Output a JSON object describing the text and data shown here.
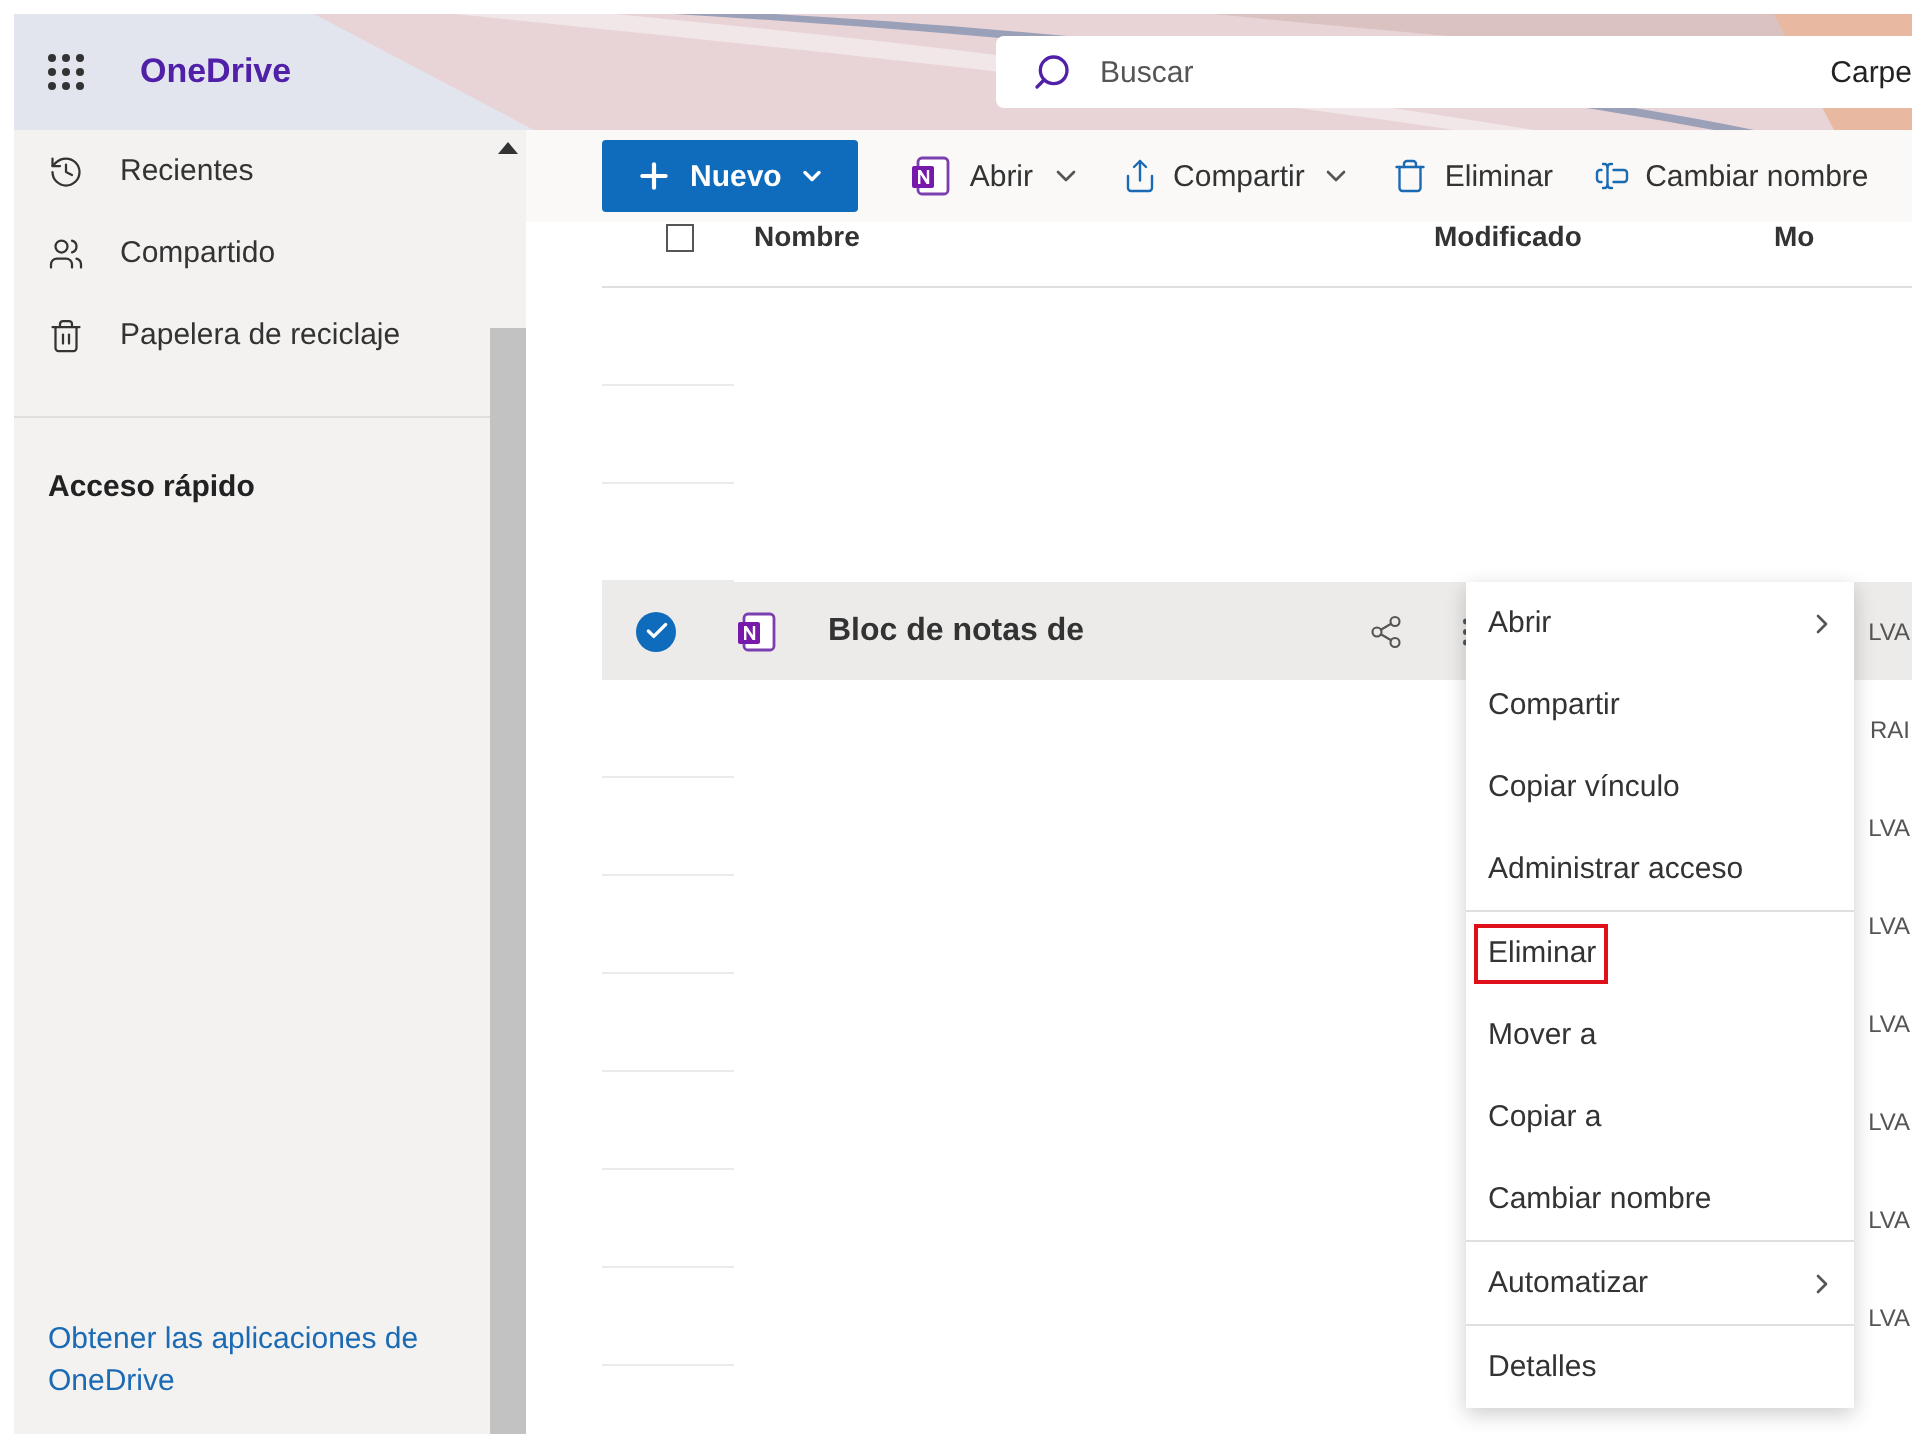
{
  "header": {
    "app_name": "OneDrive",
    "search": {
      "placeholder": "Buscar"
    },
    "search_scope": "Carpe"
  },
  "sidebar": {
    "items": [
      {
        "label": "Recientes"
      },
      {
        "label": "Compartido"
      },
      {
        "label": "Papelera de reciclaje"
      }
    ],
    "section_title": "Acceso rápido",
    "footer_link": "Obtener las aplicaciones de OneDrive"
  },
  "toolbar": {
    "items": [
      {
        "kind": "primary",
        "label": "Nuevo"
      },
      {
        "kind": "dropdown",
        "label": "Abrir"
      },
      {
        "kind": "dropdown",
        "label": "Compartir"
      },
      {
        "kind": "plain",
        "label": "Eliminar"
      },
      {
        "kind": "plain",
        "label": "Cambiar nombre"
      }
    ]
  },
  "file_list": {
    "select_all": {
      "checked": false
    },
    "columns": [
      "Nombre",
      "Modificado",
      "Mo"
    ],
    "rows": [
      {
        "selected": false
      },
      {
        "selected": false
      },
      {
        "selected": false
      },
      {
        "selected": true,
        "name": "Bloc de notas de",
        "column_4": "LVA"
      },
      {
        "selected": false,
        "column_4": "RAI"
      },
      {
        "selected": false,
        "column_4": "LVA"
      },
      {
        "selected": false,
        "column_4": "LVA"
      },
      {
        "selected": false,
        "column_4": "LVA"
      },
      {
        "selected": false,
        "column_4": "LVA"
      },
      {
        "selected": false,
        "column_4": "LVA"
      },
      {
        "selected": false,
        "column_4": "LVA"
      }
    ]
  },
  "context_menu": {
    "items": [
      {
        "label": "Abrir",
        "submenu": true,
        "highlighted": false,
        "divider_after": false
      },
      {
        "label": "Compartir",
        "submenu": false,
        "highlighted": false,
        "divider_after": false
      },
      {
        "label": "Copiar vínculo",
        "submenu": false,
        "highlighted": false,
        "divider_after": false
      },
      {
        "label": "Administrar acceso",
        "submenu": false,
        "highlighted": false,
        "divider_after": true
      },
      {
        "label": "Eliminar",
        "submenu": false,
        "highlighted": true,
        "divider_after": false
      },
      {
        "label": "Mover a",
        "submenu": false,
        "highlighted": false,
        "divider_after": false
      },
      {
        "label": "Copiar a",
        "submenu": false,
        "highlighted": false,
        "divider_after": false
      },
      {
        "label": "Cambiar nombre",
        "submenu": false,
        "highlighted": false,
        "divider_after": true
      },
      {
        "label": "Automatizar",
        "submenu": true,
        "highlighted": false,
        "divider_after": true
      },
      {
        "label": "Detalles",
        "submenu": false,
        "highlighted": false,
        "divider_after": false
      }
    ]
  }
}
